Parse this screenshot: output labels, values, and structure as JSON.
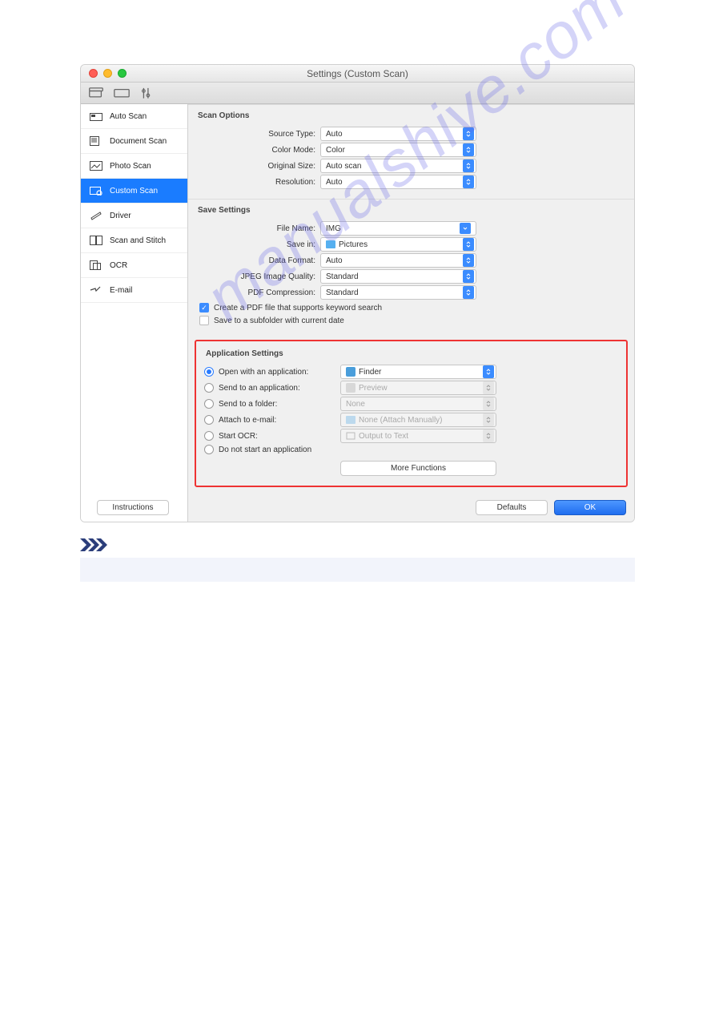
{
  "window": {
    "title": "Settings (Custom Scan)"
  },
  "sidebar": {
    "items": [
      {
        "label": "Auto Scan"
      },
      {
        "label": "Document Scan"
      },
      {
        "label": "Photo Scan"
      },
      {
        "label": "Custom Scan"
      },
      {
        "label": "Driver"
      },
      {
        "label": "Scan and Stitch"
      },
      {
        "label": "OCR"
      },
      {
        "label": "E-mail"
      }
    ]
  },
  "scan_options": {
    "title": "Scan Options",
    "source_type_label": "Source Type:",
    "source_type_value": "Auto",
    "color_mode_label": "Color Mode:",
    "color_mode_value": "Color",
    "original_size_label": "Original Size:",
    "original_size_value": "Auto scan",
    "resolution_label": "Resolution:",
    "resolution_value": "Auto"
  },
  "save_settings": {
    "title": "Save Settings",
    "file_name_label": "File Name:",
    "file_name_value": "IMG",
    "save_in_label": "Save in:",
    "save_in_value": "Pictures",
    "data_format_label": "Data Format:",
    "data_format_value": "Auto",
    "jpeg_label": "JPEG Image Quality:",
    "jpeg_value": "Standard",
    "pdf_label": "PDF Compression:",
    "pdf_value": "Standard",
    "pdf_keyword_label": "Create a PDF file that supports keyword search",
    "subfolder_label": "Save to a subfolder with current date"
  },
  "app_settings": {
    "title": "Application Settings",
    "open_with_label": "Open with an application:",
    "open_with_value": "Finder",
    "send_app_label": "Send to an application:",
    "send_app_value": "Preview",
    "send_folder_label": "Send to a folder:",
    "send_folder_value": "None",
    "attach_label": "Attach to e-mail:",
    "attach_value": "None (Attach Manually)",
    "ocr_label": "Start OCR:",
    "ocr_value": "Output to Text",
    "no_start_label": "Do not start an application",
    "more_functions": "More Functions"
  },
  "footer": {
    "instructions": "Instructions",
    "defaults": "Defaults",
    "ok": "OK"
  },
  "watermark": "manualshive.com"
}
